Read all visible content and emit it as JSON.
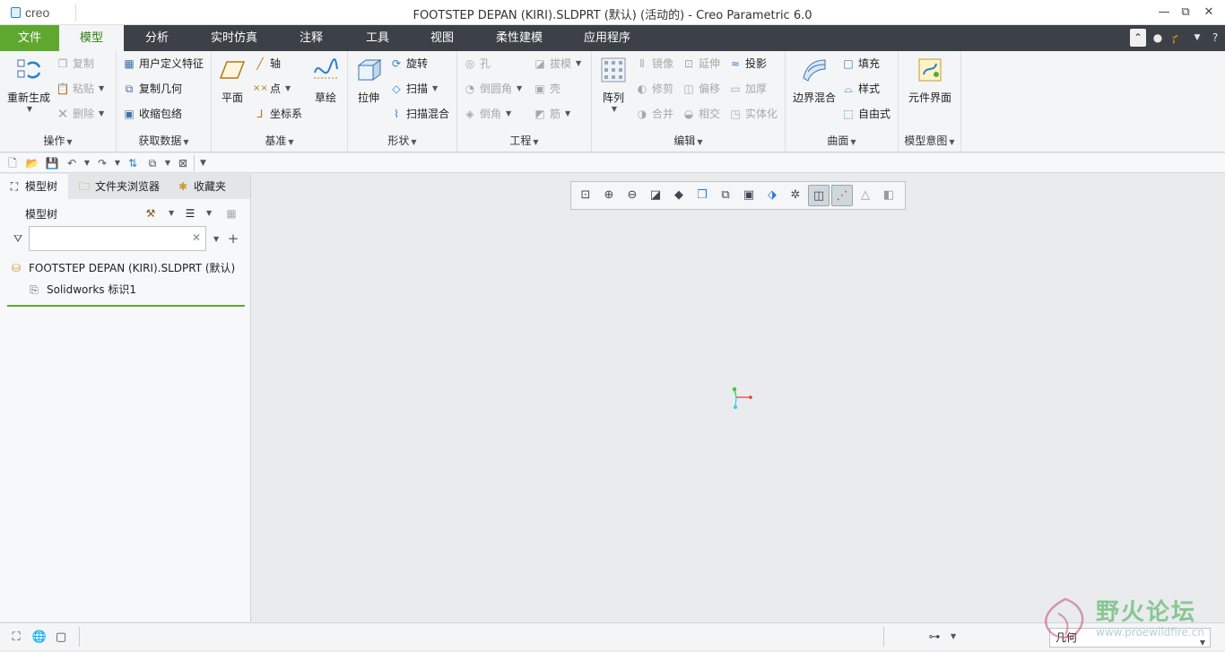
{
  "app": {
    "logo_text": "creo",
    "window_title": "FOOTSTEP DEPAN (KIRI).SLDPRT (默认) (活动的) - Creo Parametric 6.0",
    "window_controls": [
      "—",
      "⧉",
      "✕"
    ]
  },
  "menu": {
    "tabs": [
      "文件",
      "模型",
      "分析",
      "实时仿真",
      "注释",
      "工具",
      "视图",
      "柔性建模",
      "应用程序"
    ],
    "active_tab": "模型"
  },
  "ribbon": {
    "operations": {
      "label": "操作",
      "regenerate": "重新生成",
      "copy": "复制",
      "paste": "粘贴",
      "delete": "删除"
    },
    "get_data": {
      "label": "获取数据",
      "udf": "用户定义特征",
      "copy_geom": "复制几何",
      "shrinkwrap": "收缩包络"
    },
    "datum": {
      "label": "基准",
      "plane": "平面",
      "axis": "轴",
      "point": "点",
      "csys": "坐标系",
      "sketch": "草绘"
    },
    "shapes": {
      "label": "形状",
      "extrude": "拉伸",
      "revolve": "旋转",
      "sweep": "扫描",
      "swept_blend": "扫描混合"
    },
    "engineering": {
      "label": "工程",
      "hole": "孔",
      "draft": "拔模",
      "round": "倒圆角",
      "shell": "壳",
      "chamfer": "倒角",
      "rib": "筋"
    },
    "editing": {
      "label": "编辑",
      "pattern": "阵列",
      "mirror": "镜像",
      "extend": "延伸",
      "project": "投影",
      "trim": "修剪",
      "offset": "偏移",
      "thicken": "加厚",
      "merge": "合并",
      "intersect": "相交",
      "solidify": "实体化"
    },
    "surfaces": {
      "label": "曲面",
      "boundary_blend": "边界混合",
      "fill": "填充",
      "style": "样式",
      "freestyle": "自由式"
    },
    "model_intent": {
      "label": "模型意图",
      "component_interface": "元件界面"
    }
  },
  "panel": {
    "tabs": [
      "模型树",
      "文件夹浏览器",
      "收藏夹"
    ],
    "tree_title": "模型树",
    "search_value": "",
    "tree_items": [
      "FOOTSTEP DEPAN (KIRI).SLDPRT (默认)",
      "Solidworks 标识1"
    ]
  },
  "status": {
    "filter_value": "几何"
  },
  "watermark": {
    "title": "野火论坛",
    "url": "www.proewildfire.cn"
  },
  "colors": {
    "accent_green": "#5fa830",
    "menubar": "#3b4146",
    "axis_x": "#e53935",
    "axis_y": "#43c043",
    "axis_z": "#40c8e0"
  }
}
